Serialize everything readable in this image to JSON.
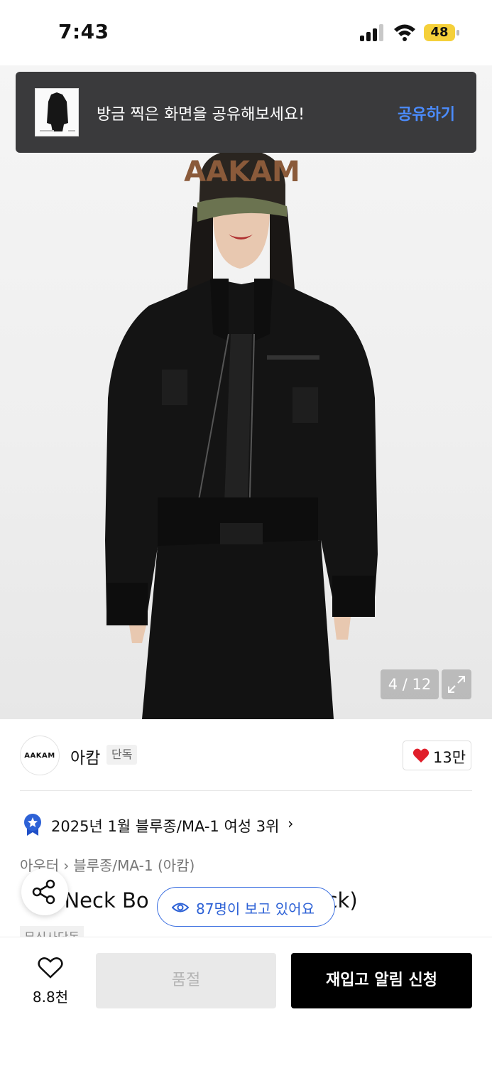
{
  "status_bar": {
    "time": "7:43",
    "battery": "48"
  },
  "share_toast": {
    "message": "방금 찍은 화면을 공유해보세요!",
    "action": "공유하기"
  },
  "image_viewer": {
    "counter": "4 / 12",
    "hero_logo_text": "AAKAM"
  },
  "brand": {
    "logo_text": "AAKAM",
    "name": "아캄",
    "badge": "단독",
    "like_count": "13만"
  },
  "ranking": {
    "text": "2025년 1월 블루종/MA-1 여성 3위",
    "chevron": "›"
  },
  "breadcrumb": {
    "first": "아우터",
    "separator": "›",
    "second": "블루종/MA-1 (아캄)"
  },
  "product": {
    "title_visible_left": "-Neck Bo",
    "title_visible_right": "ck)",
    "tag_partial": "무신사단독"
  },
  "viewers": {
    "text": "87명이 보고 있어요"
  },
  "bottom_bar": {
    "wish_count": "8.8천",
    "soldout_label": "품절",
    "restock_label": "재입고 알림 신청"
  },
  "colors": {
    "accent_blue": "#2e62d6",
    "heart_red": "#e01e2a",
    "toast_bg": "#3a3a3c",
    "battery_yellow": "#f5d03a"
  }
}
